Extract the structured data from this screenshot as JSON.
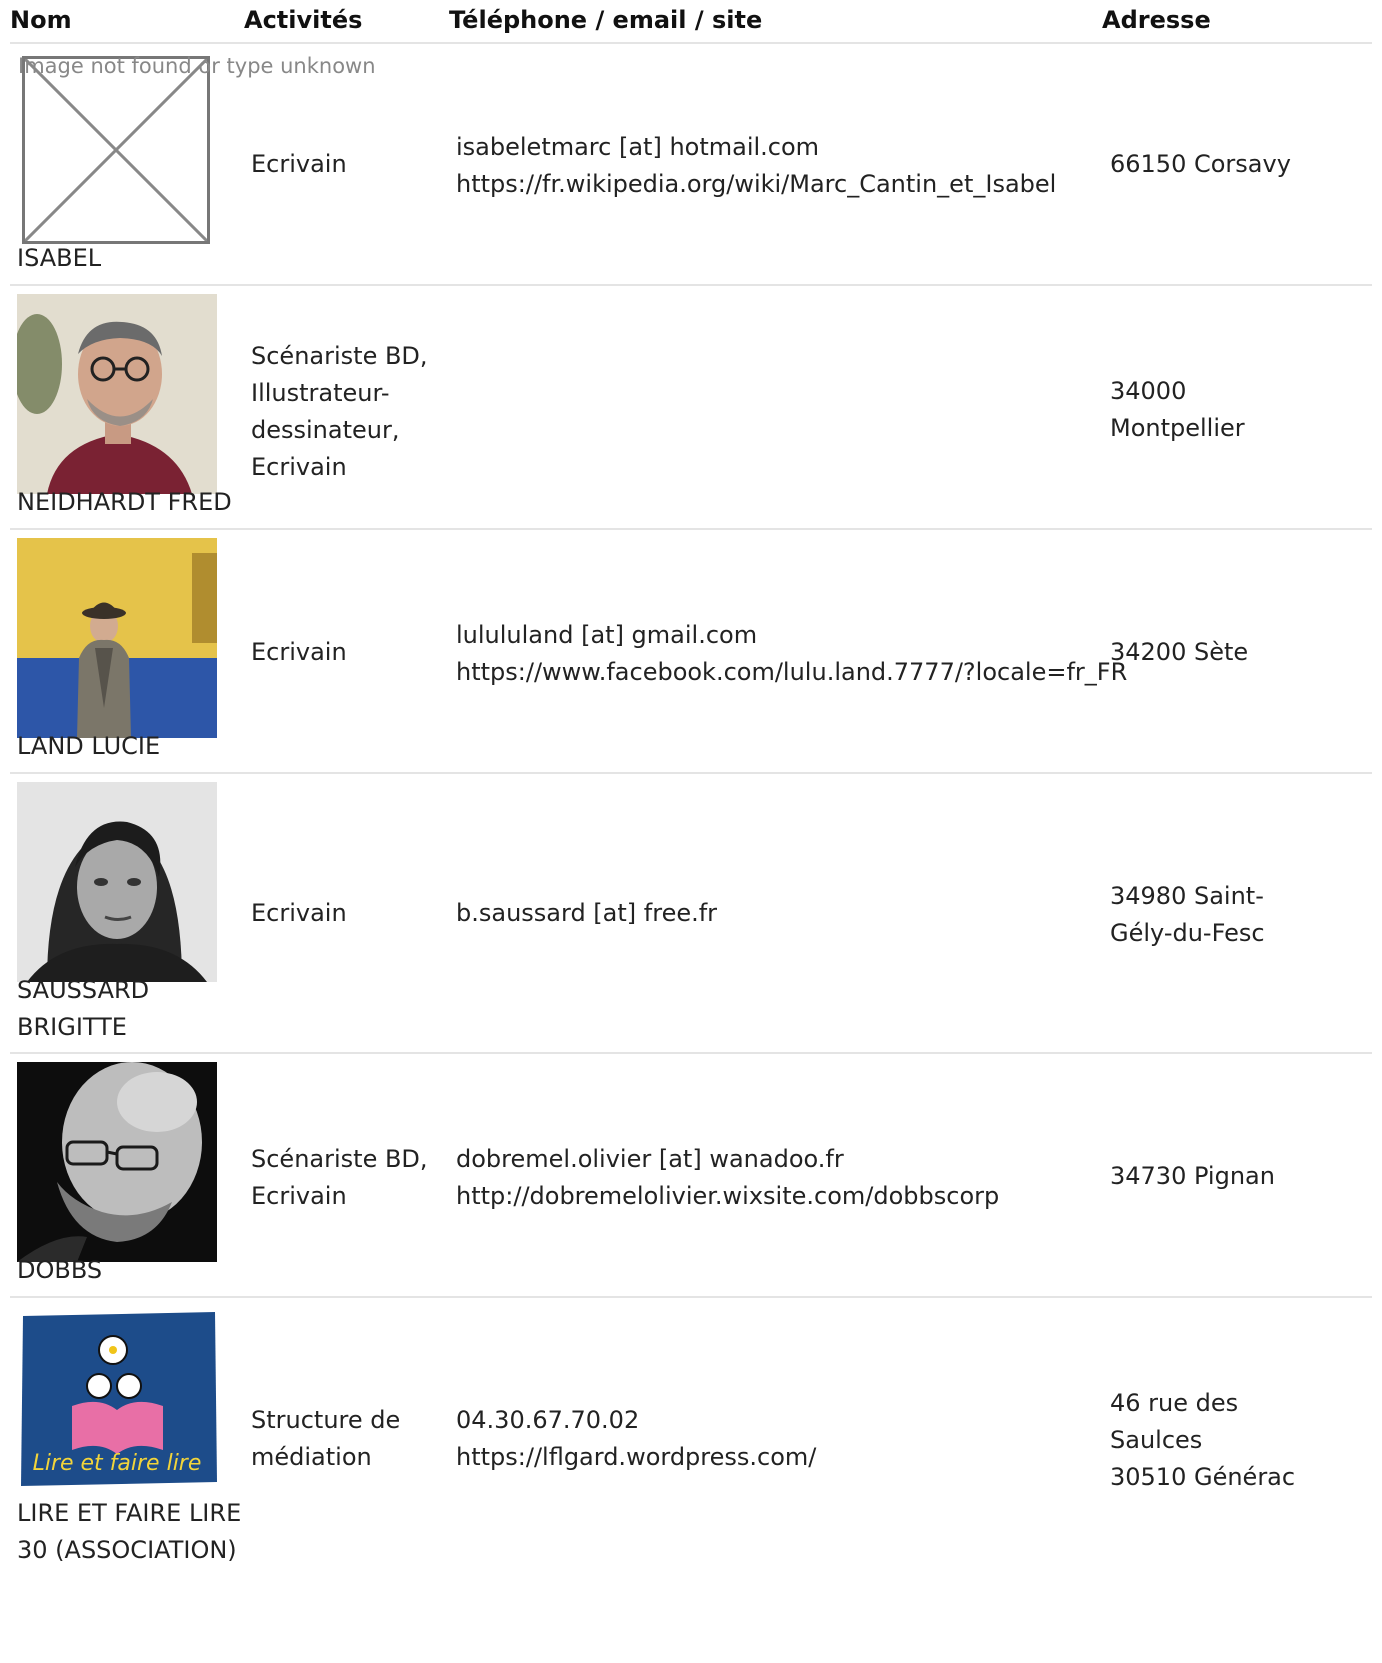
{
  "headers": {
    "nom": "Nom",
    "activites": "Activités",
    "contact": "Téléphone / email / site",
    "adresse": "Adresse"
  },
  "broken_image_text": "Image not found or type unknown",
  "rows": [
    {
      "name_lines": [
        "ISABEL"
      ],
      "activity_lines": [
        "Ecrivain"
      ],
      "contact_lines": [
        "isabeletmarc [at] hotmail.com",
        "https://fr.wikipedia.org/wiki/Marc_Cantin_et_Isabel"
      ],
      "address_lines": [
        "66150 Corsavy"
      ],
      "photo": "broken-image"
    },
    {
      "name_lines": [
        "NEIDHARDT FRED"
      ],
      "activity_lines": [
        "Scénariste BD,",
        "Illustrateur-",
        "dessinateur,",
        "Ecrivain"
      ],
      "contact_lines": [],
      "address_lines": [
        "34000",
        "Montpellier"
      ],
      "photo": "portrait-man-glasses"
    },
    {
      "name_lines": [
        "LAND LUCIE"
      ],
      "activity_lines": [
        "Ecrivain"
      ],
      "contact_lines": [
        "lulululand [at] gmail.com",
        "https://www.facebook.com/lulu.land.7777/?locale=fr_FR"
      ],
      "address_lines": [
        "34200 Sète"
      ],
      "photo": "portrait-woman-hat"
    },
    {
      "name_lines": [
        "SAUSSARD",
        "BRIGITTE"
      ],
      "activity_lines": [
        "Ecrivain"
      ],
      "contact_lines": [
        "b.saussard [at] free.fr"
      ],
      "address_lines": [
        "34980 Saint-",
        "Gély-du-Fesc"
      ],
      "photo": "portrait-woman-bw"
    },
    {
      "name_lines": [
        "DOBBS"
      ],
      "activity_lines": [
        "Scénariste BD,",
        "Ecrivain"
      ],
      "contact_lines": [
        "dobremel.olivier [at] wanadoo.fr",
        "http://dobremelolivier.wixsite.com/dobbscorp"
      ],
      "address_lines": [
        "34730 Pignan"
      ],
      "photo": "portrait-man-bw"
    },
    {
      "name_lines": [
        "LIRE ET FAIRE LIRE",
        "30 (ASSOCIATION)"
      ],
      "activity_lines": [
        "Structure de",
        "médiation"
      ],
      "contact_lines": [
        "04.30.67.70.02",
        "https://lflgard.wordpress.com/"
      ],
      "address_lines": [
        "46 rue des",
        "Saulces",
        "30510 Générac"
      ],
      "photo": "lire-et-faire-lire-logo",
      "logo_text": "Lire et faire lire"
    }
  ]
}
